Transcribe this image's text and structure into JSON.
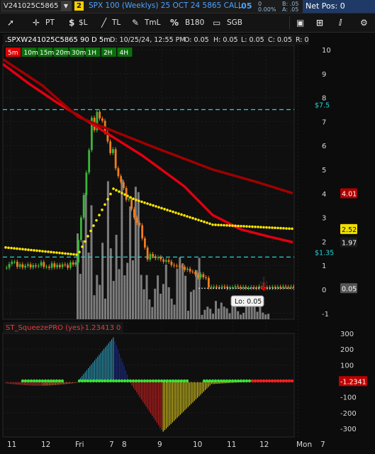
{
  "quote": {
    "symbol": "V241025C5865",
    "link_number": "2",
    "description": "SPX 100 (Weeklys) 25 OCT 24 5865 CALL",
    "last": ".05",
    "change": "0",
    "change_pct": "0.00%",
    "bid": "B: .05",
    "ask": "A: .05",
    "net_pos": "Net Pos: 0"
  },
  "toolbar": {
    "pointer_label": "PT",
    "price_label": "$L",
    "trendline_label": "TL",
    "timeline_label": "TmL",
    "b180_label": "B180",
    "sgb_label": "SGB",
    "pointer_icon": "cursor-icon",
    "price_icon": "dollar-icon",
    "draw_icon": "pencil-icon",
    "percent_icon": "percent-icon",
    "screen_icon": "monitor-icon",
    "grid_icon": "grid-icon",
    "gear_icon": "gear-icon"
  },
  "chart": {
    "info": ".SPXW241025C5865 90 D 5m",
    "date": "D: 10/25/24, 12:55 PM",
    "open": "O: 0.05",
    "high": "H: 0.05",
    "low": "L: 0.05",
    "close": "C: 0.05",
    "range": "R: 0",
    "timeframes": [
      "5m",
      "10m",
      "15m",
      "20m",
      "30m",
      "1H",
      "2H",
      "4H"
    ],
    "active_timeframe": "5m",
    "lines": [
      {
        "label": "$7.5",
        "value": 7.5,
        "color": "#29d3d3"
      },
      {
        "label": "$1.35",
        "value": 1.35,
        "color": "#29d3d3"
      }
    ],
    "price_axis": [
      "10",
      "9",
      "8",
      "7",
      "6",
      "5",
      "4",
      "3",
      "2",
      "1",
      "0",
      "-1"
    ],
    "price_flags": [
      {
        "text": "4.01",
        "value": 4.01,
        "bg": "#b00000",
        "fg": "#ffffff"
      },
      {
        "text": "2.52",
        "value": 2.52,
        "bg": "#f0e000",
        "fg": "#111111"
      },
      {
        "text": "1.97",
        "value": 1.97,
        "bg": "#1a1a1a",
        "fg": "#ffffff"
      },
      {
        "text": "0.05",
        "value": 0.05,
        "bg": "#555555",
        "fg": "#ffffff"
      }
    ],
    "low_bubble": "Lo: 0.05",
    "x_axis": [
      "11",
      "12",
      "Fri",
      "7",
      "8",
      "9",
      "10",
      "11",
      "12",
      "Mon",
      "7"
    ]
  },
  "lower": {
    "title": "ST_SqueezePRO (yes)",
    "value": "-1.23413",
    "zero": "0",
    "axis": [
      "300",
      "200",
      "100",
      "0",
      "-100",
      "-200",
      "-300"
    ],
    "flag": "-1.2341"
  },
  "colors": {
    "accent": "#4aa3ff",
    "ma_red": "#c8102e",
    "ma_dark_red": "#a00000",
    "yellow_dots": "#ffe600",
    "candle_up": "#3cb43c",
    "candle_down": "#f07d1e"
  }
}
